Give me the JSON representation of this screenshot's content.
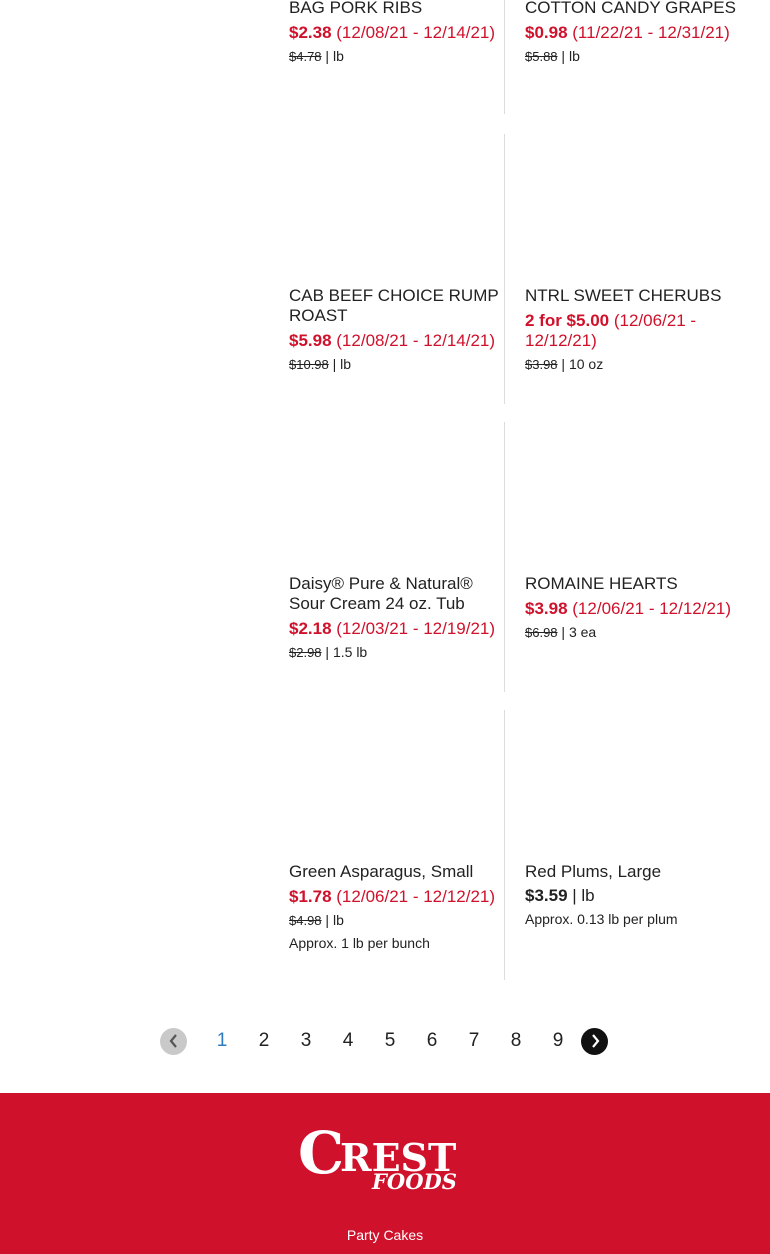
{
  "products": [
    {
      "name": "BAG PORK RIBS",
      "price": "$2.38",
      "dates": " (12/08/21 - 12/14/21)",
      "reg": "$4.78",
      "unit": " | lb"
    },
    {
      "name": "COTTON CANDY GRAPES",
      "price": "$0.98",
      "dates": " (11/22/21 - 12/31/21)",
      "reg": "$5.88",
      "unit": " | lb"
    },
    {
      "name": "CAB BEEF CHOICE RUMP ROAST",
      "price": "$5.98",
      "dates": " (12/08/21 - 12/14/21)",
      "reg": "$10.98",
      "unit": " | lb"
    },
    {
      "name": "NTRL SWEET CHERUBS",
      "price": "2 for $5.00",
      "dates": " (12/06/21 - 12/12/21)",
      "reg": "$3.98",
      "unit": " | 10 oz"
    },
    {
      "name": "Daisy® Pure & Natural® Sour Cream 24 oz. Tub",
      "price": "$2.18",
      "dates": " (12/03/21 - 12/19/21)",
      "reg": "$2.98",
      "unit": " | 1.5 lb"
    },
    {
      "name": "ROMAINE HEARTS",
      "price": "$3.98",
      "dates": " (12/06/21 - 12/12/21)",
      "reg": "$6.98",
      "unit": " | 3 ea"
    },
    {
      "name": "Green Asparagus, Small",
      "price": "$1.78",
      "dates": " (12/06/21 - 12/12/21)",
      "reg": "$4.98",
      "unit": " | lb",
      "note": "Approx. 1 lb per bunch"
    },
    {
      "name": "Red Plums, Large",
      "price": "$3.59",
      "unit": " | lb",
      "note": "Approx. 0.13 lb per plum"
    }
  ],
  "pagination": {
    "pages": [
      "1",
      "2",
      "3",
      "4",
      "5",
      "6",
      "7",
      "8",
      "9"
    ],
    "current": "1"
  },
  "footer": {
    "logo_text": "CREST FOODS",
    "link": "Party Cakes"
  },
  "colors": {
    "brand_red": "#d0112b",
    "active_page": "#2f7bbf"
  }
}
